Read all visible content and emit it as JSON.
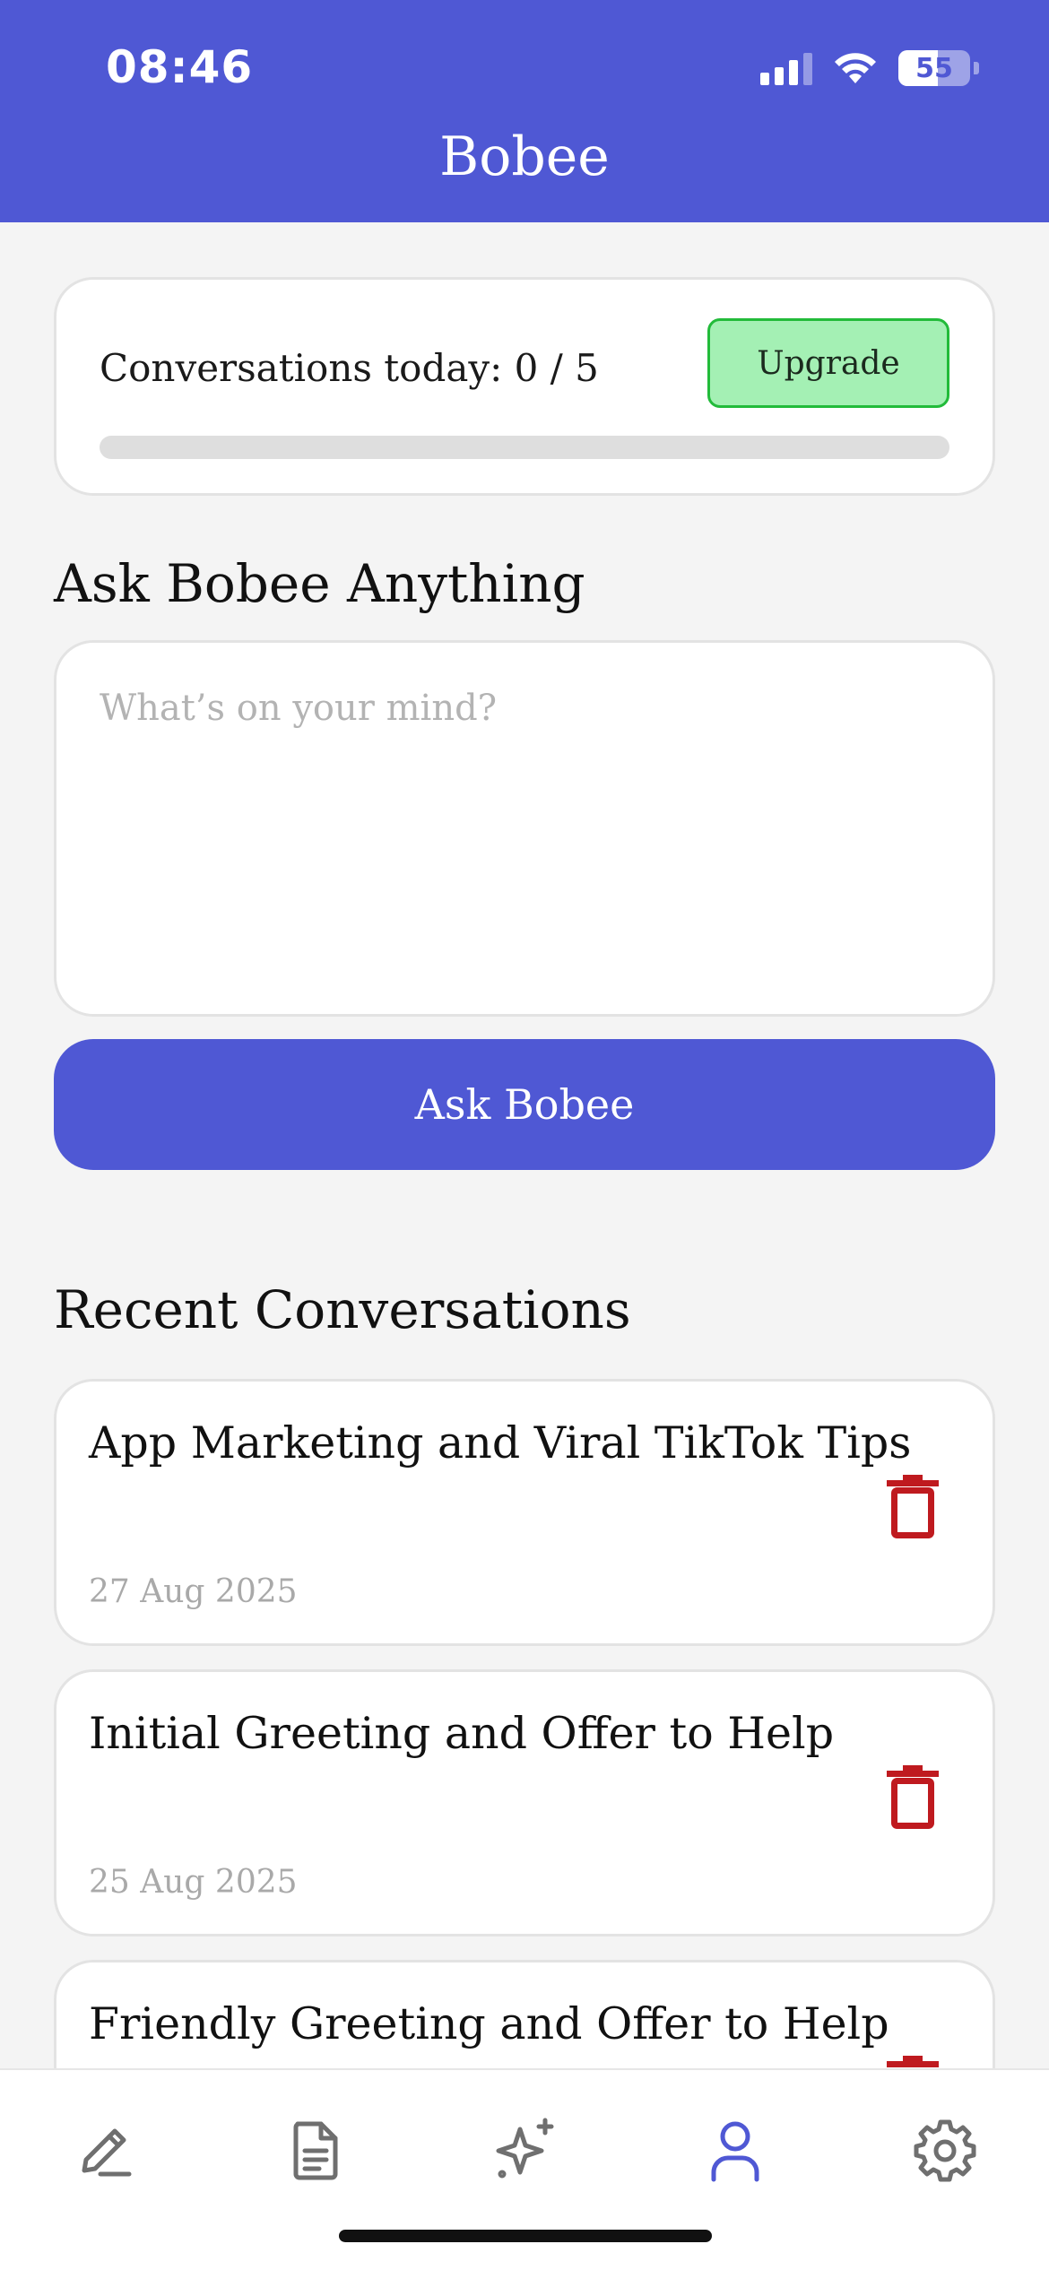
{
  "status_bar": {
    "time": "08:46",
    "battery": "55"
  },
  "header": {
    "title": "Bobee"
  },
  "usage": {
    "label": "Conversations today: 0 / 5",
    "used": 0,
    "limit": 5,
    "upgrade_label": "Upgrade"
  },
  "ask": {
    "heading": "Ask Bobee Anything",
    "placeholder": "What’s on your mind?",
    "button_label": "Ask Bobee"
  },
  "recent": {
    "heading": "Recent Conversations",
    "items": [
      {
        "title": "App Marketing and Viral TikTok Tips",
        "date": "27 Aug 2025"
      },
      {
        "title": "Initial Greeting and Offer to Help",
        "date": "25 Aug 2025"
      },
      {
        "title": "Friendly Greeting and Offer to Help",
        "date": ""
      }
    ]
  },
  "tabs": [
    {
      "name": "compose",
      "icon": "pencil-icon",
      "active": false
    },
    {
      "name": "documents",
      "icon": "document-icon",
      "active": false
    },
    {
      "name": "ai",
      "icon": "sparkle-icon",
      "active": false
    },
    {
      "name": "profile",
      "icon": "person-icon",
      "active": true
    },
    {
      "name": "settings",
      "icon": "gear-icon",
      "active": false
    }
  ],
  "colors": {
    "brand": "#4f58d4",
    "upgrade_bg": "#a4f0b4",
    "upgrade_border": "#22bb3a",
    "delete": "#bf1a1f",
    "tab_inactive": "#6f6f6f"
  }
}
